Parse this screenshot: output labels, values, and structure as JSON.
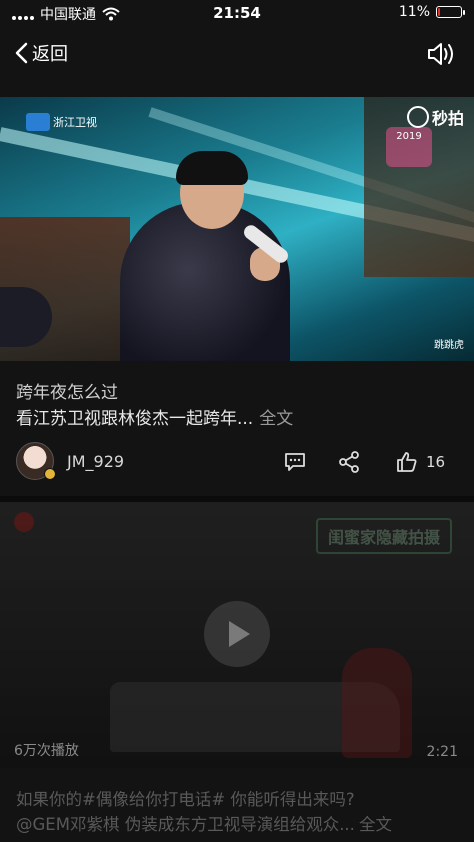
{
  "status_bar": {
    "carrier": "中国联通",
    "time": "21:54",
    "battery_percent": "11%",
    "battery_level": 0.11
  },
  "nav": {
    "back_label": "返回",
    "sound_icon": "speaker-icon"
  },
  "video1": {
    "channel_logo": "浙江卫视",
    "watermark": "秒拍",
    "event_badge": "2019",
    "corner_tag": "跳跳虎"
  },
  "post1": {
    "title": "跨年夜怎么过",
    "description": "看江苏卫视跟林俊杰一起跨年...",
    "more_label": "全文",
    "author_name": "JM_929",
    "like_count": "16"
  },
  "video2": {
    "overlay_tag": "闺蜜家隐藏拍摄",
    "views": "6万次播放",
    "duration": "2:21"
  },
  "post2": {
    "title": "如果你的#偶像给你打电话# 你能听得出来吗?",
    "description": "@GEM邓紫棋 伪装成东方卫视导演组给观众...",
    "more_label": "全文"
  },
  "colors": {
    "background": "#131313",
    "battery_low": "#e0352b",
    "text_primary": "#e8e8e8",
    "text_muted": "#595959"
  }
}
